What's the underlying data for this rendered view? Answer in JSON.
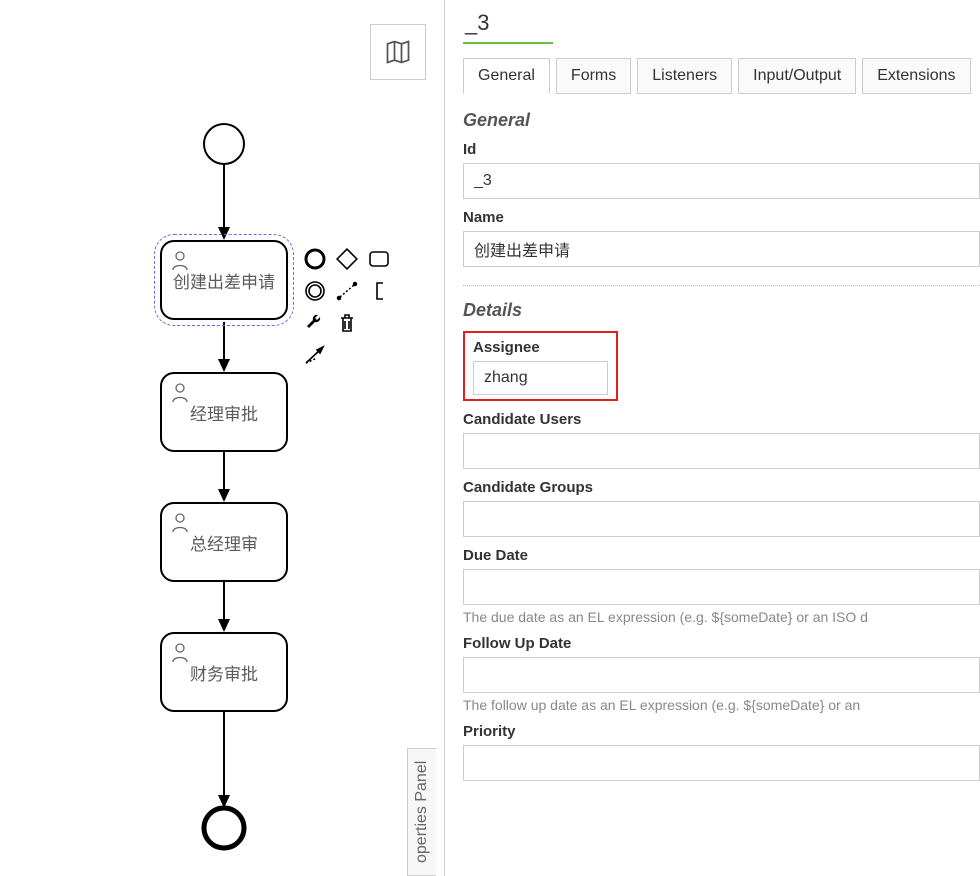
{
  "header": {
    "title": "_3"
  },
  "tabs": [
    {
      "label": "General",
      "active": true
    },
    {
      "label": "Forms",
      "active": false
    },
    {
      "label": "Listeners",
      "active": false
    },
    {
      "label": "Input/Output",
      "active": false
    },
    {
      "label": "Extensions",
      "active": false
    }
  ],
  "sections": {
    "general_title": "General",
    "details_title": "Details"
  },
  "fields": {
    "id_label": "Id",
    "id_value": "_3",
    "name_label": "Name",
    "name_value": "创建出差申请",
    "assignee_label": "Assignee",
    "assignee_value": "zhang",
    "candidate_users_label": "Candidate Users",
    "candidate_users_value": "",
    "candidate_groups_label": "Candidate Groups",
    "candidate_groups_value": "",
    "due_date_label": "Due Date",
    "due_date_value": "",
    "due_date_hint": "The due date as an EL expression (e.g. ${someDate} or an ISO d",
    "follow_up_date_label": "Follow Up Date",
    "follow_up_date_value": "",
    "follow_up_date_hint": "The follow up date as an EL expression (e.g. ${someDate} or an",
    "priority_label": "Priority",
    "priority_value": ""
  },
  "canvas": {
    "tasks": [
      {
        "label": "创建出差申请",
        "selected": true
      },
      {
        "label": "经理审批",
        "selected": false
      },
      {
        "label": "总经理审",
        "selected": false
      },
      {
        "label": "财务审批",
        "selected": false
      }
    ]
  },
  "side_tab": "operties Panel",
  "context_pad": {
    "items": [
      "end-event-icon",
      "gateway-icon",
      "task-icon",
      "intermediate-event-icon",
      "connect-icon",
      "text-annotation-icon",
      "wrench-icon",
      "trash-icon",
      "",
      "sequence-flow-icon",
      "",
      ""
    ]
  }
}
